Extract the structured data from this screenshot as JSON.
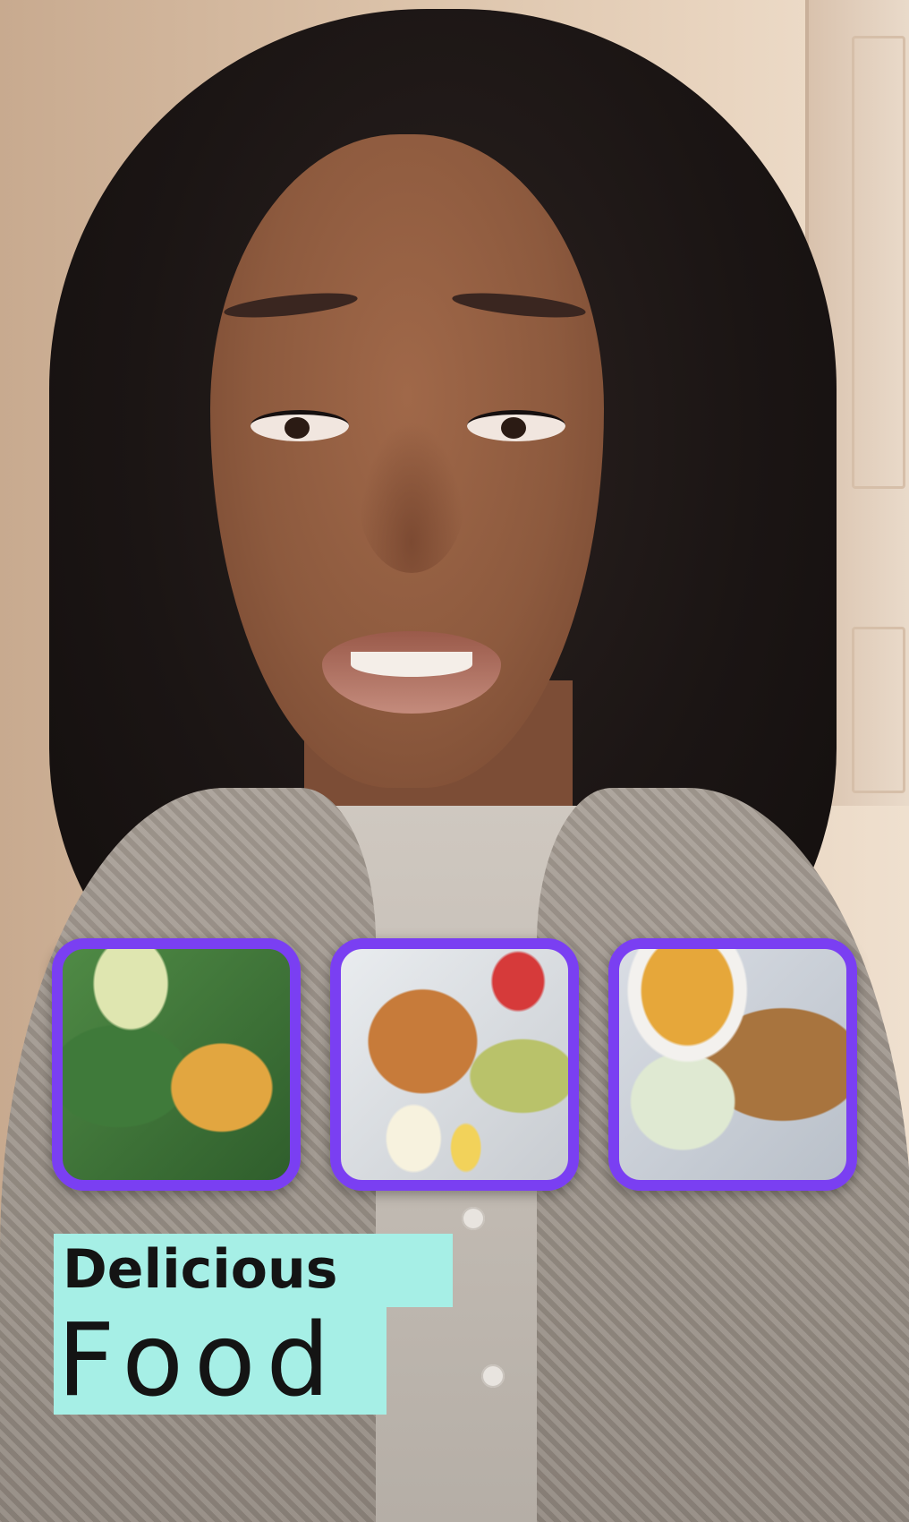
{
  "caption": {
    "line1": "Delicious",
    "line2": "Food"
  },
  "food_tiles": [
    {
      "icon": "stuffed-pepper-salad-image"
    },
    {
      "icon": "salmon-cake-eggs-avocado-image"
    },
    {
      "icon": "crispy-chicken-tenders-image"
    }
  ],
  "colors": {
    "tile_border": "#7a3ff2",
    "caption_background": "#a6efe6",
    "caption_text": "#141414"
  }
}
